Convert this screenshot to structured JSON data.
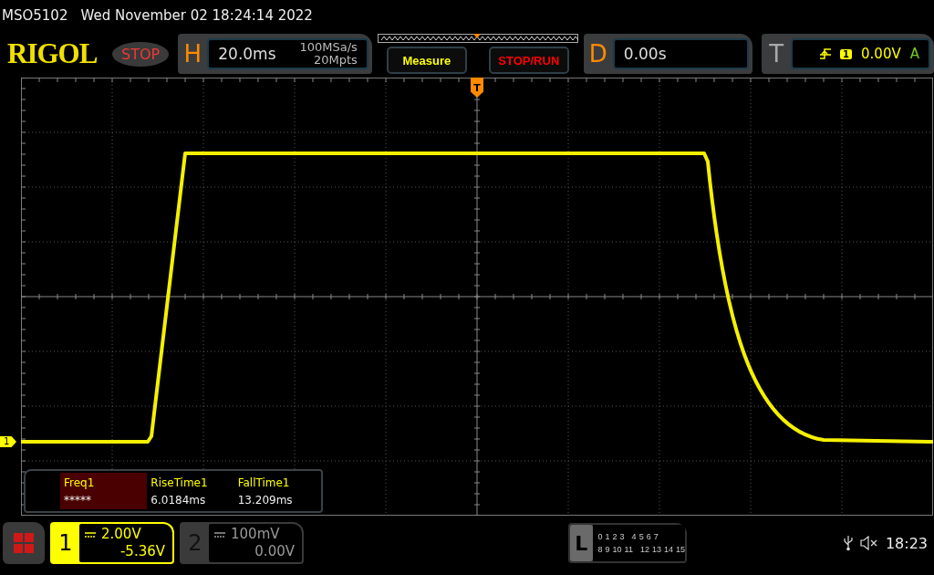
{
  "title_bar": {
    "model": "MSO5102",
    "datetime": "Wed November 02 18:24:14 2022"
  },
  "header": {
    "logo": "RIGOL",
    "run_state": "STOP",
    "horizontal": {
      "label": "H",
      "timebase": "20.0ms",
      "sample_rate": "100MSa/s",
      "memory_depth": "20Mpts"
    },
    "buttons": [
      "Measure",
      "STOP/RUN"
    ],
    "delay": {
      "label": "D",
      "value": "0.00s"
    },
    "trigger": {
      "label": "T",
      "source": "1",
      "level": "0.00V",
      "mode": "A"
    }
  },
  "graticule": {
    "trigger_marker": "T",
    "channel_marker": "1"
  },
  "measurements": [
    {
      "name": "Freq1",
      "value": "*****",
      "selected": true
    },
    {
      "name": "RiseTime1",
      "value": "6.0184ms",
      "selected": false
    },
    {
      "name": "FallTime1",
      "value": "13.209ms",
      "selected": false
    }
  ],
  "channels": [
    {
      "number": "1",
      "scale": "2.00V",
      "offset": "-5.36V",
      "active": true
    },
    {
      "number": "2",
      "scale": "100mV",
      "offset": "0.00V",
      "active": false
    }
  ],
  "logic": {
    "label": "L",
    "row_1": [
      "0",
      "1",
      "2",
      "3",
      "4",
      "5",
      "6",
      "7"
    ],
    "row_2": [
      "8",
      "9",
      "10",
      "11",
      "12",
      "13",
      "14",
      "15"
    ]
  },
  "status": {
    "clock": "18:23"
  }
}
